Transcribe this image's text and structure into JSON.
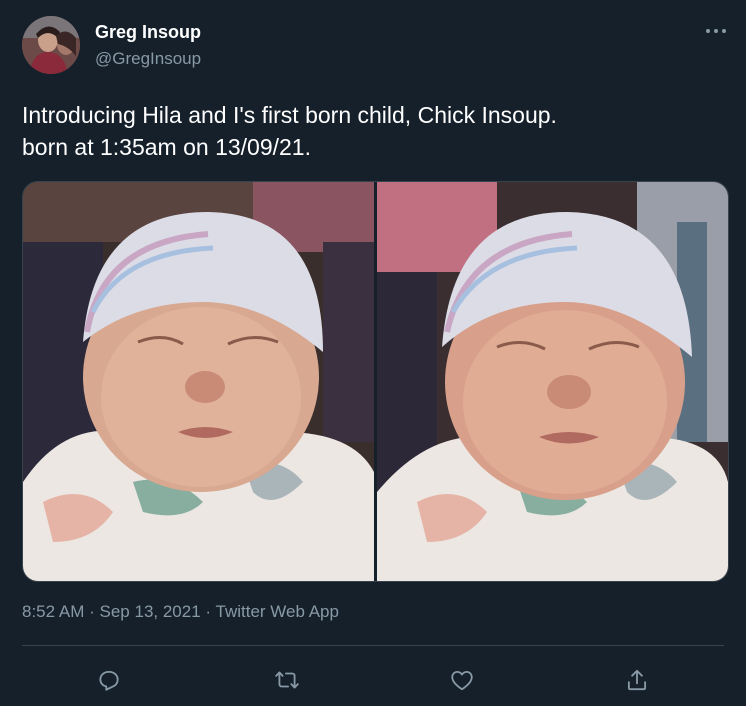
{
  "author": {
    "name": "Greg Insoup",
    "handle": "@GregInsoup"
  },
  "tweet": {
    "text_line1": "Introducing Hila and I's first born child, Chick Insoup.",
    "text_line2": "born at 1:35am on 13/09/21."
  },
  "meta": {
    "time": "8:52 AM",
    "date": "Sep 13, 2021",
    "source": "Twitter Web App",
    "separator": "·"
  },
  "icons": {
    "more": "more-horizontal-icon",
    "reply": "reply-icon",
    "retweet": "retweet-icon",
    "like": "heart-icon",
    "share": "share-icon"
  },
  "colors": {
    "background": "#15202b",
    "secondary_text": "#8899a6",
    "divider": "#38444d"
  }
}
